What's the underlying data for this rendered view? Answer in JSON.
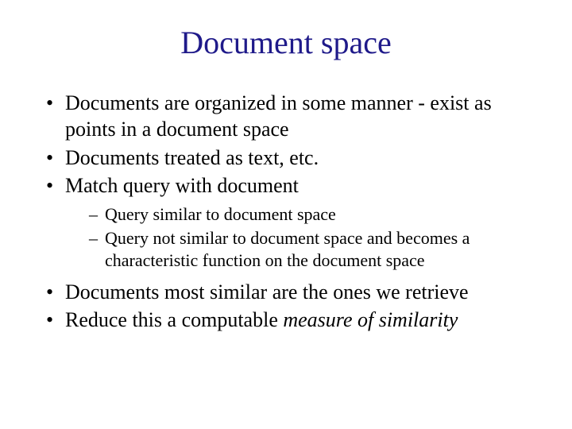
{
  "title": "Document space",
  "bullets": {
    "b0": "Documents are organized in some manner - exist as points in a document space",
    "b1": "Documents treated as text, etc.",
    "b2": "Match query with document",
    "b2_sub": {
      "s0": "Query similar to document space",
      "s1": "Query not similar to document space and becomes a characteristic function on the document space"
    },
    "b3": "Documents most similar are the ones we retrieve",
    "b4_prefix": "Reduce this a computable ",
    "b4_italic": "measure of similarity"
  }
}
